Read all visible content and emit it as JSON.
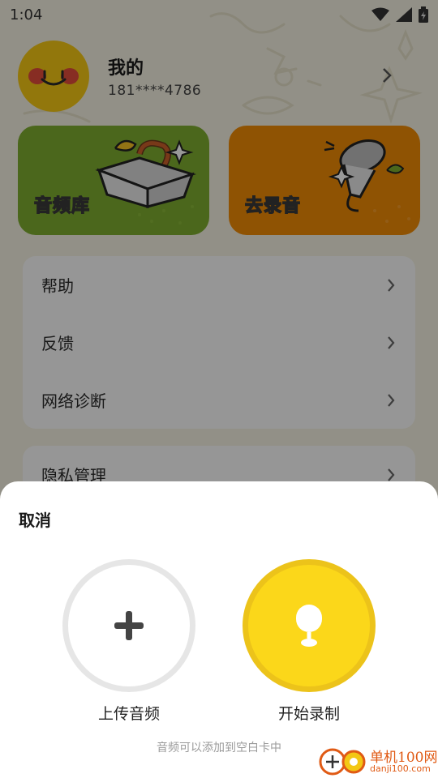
{
  "status_bar": {
    "time": "1:04",
    "icons": [
      "wifi-icon",
      "signal-icon",
      "battery-icon"
    ]
  },
  "profile": {
    "name": "我的",
    "phone": "181****4786"
  },
  "cards": [
    {
      "label": "音频库",
      "color": "#7dac2f"
    },
    {
      "label": "去录音",
      "color": "#ef8a06"
    }
  ],
  "menu_group_1": [
    {
      "label": "帮助"
    },
    {
      "label": "反馈"
    },
    {
      "label": "网络诊断"
    }
  ],
  "menu_group_2": [
    {
      "label": "隐私管理"
    }
  ],
  "sheet": {
    "cancel": "取消",
    "upload_label": "上传音频",
    "record_label": "开始录制",
    "hint": "音频可以添加到空白卡中"
  },
  "watermark": {
    "name": "单机100网",
    "url": "danji100.com"
  },
  "colors": {
    "accent": "#fbd71a",
    "library_card": "#7dac2f",
    "record_card": "#ef8a06"
  }
}
